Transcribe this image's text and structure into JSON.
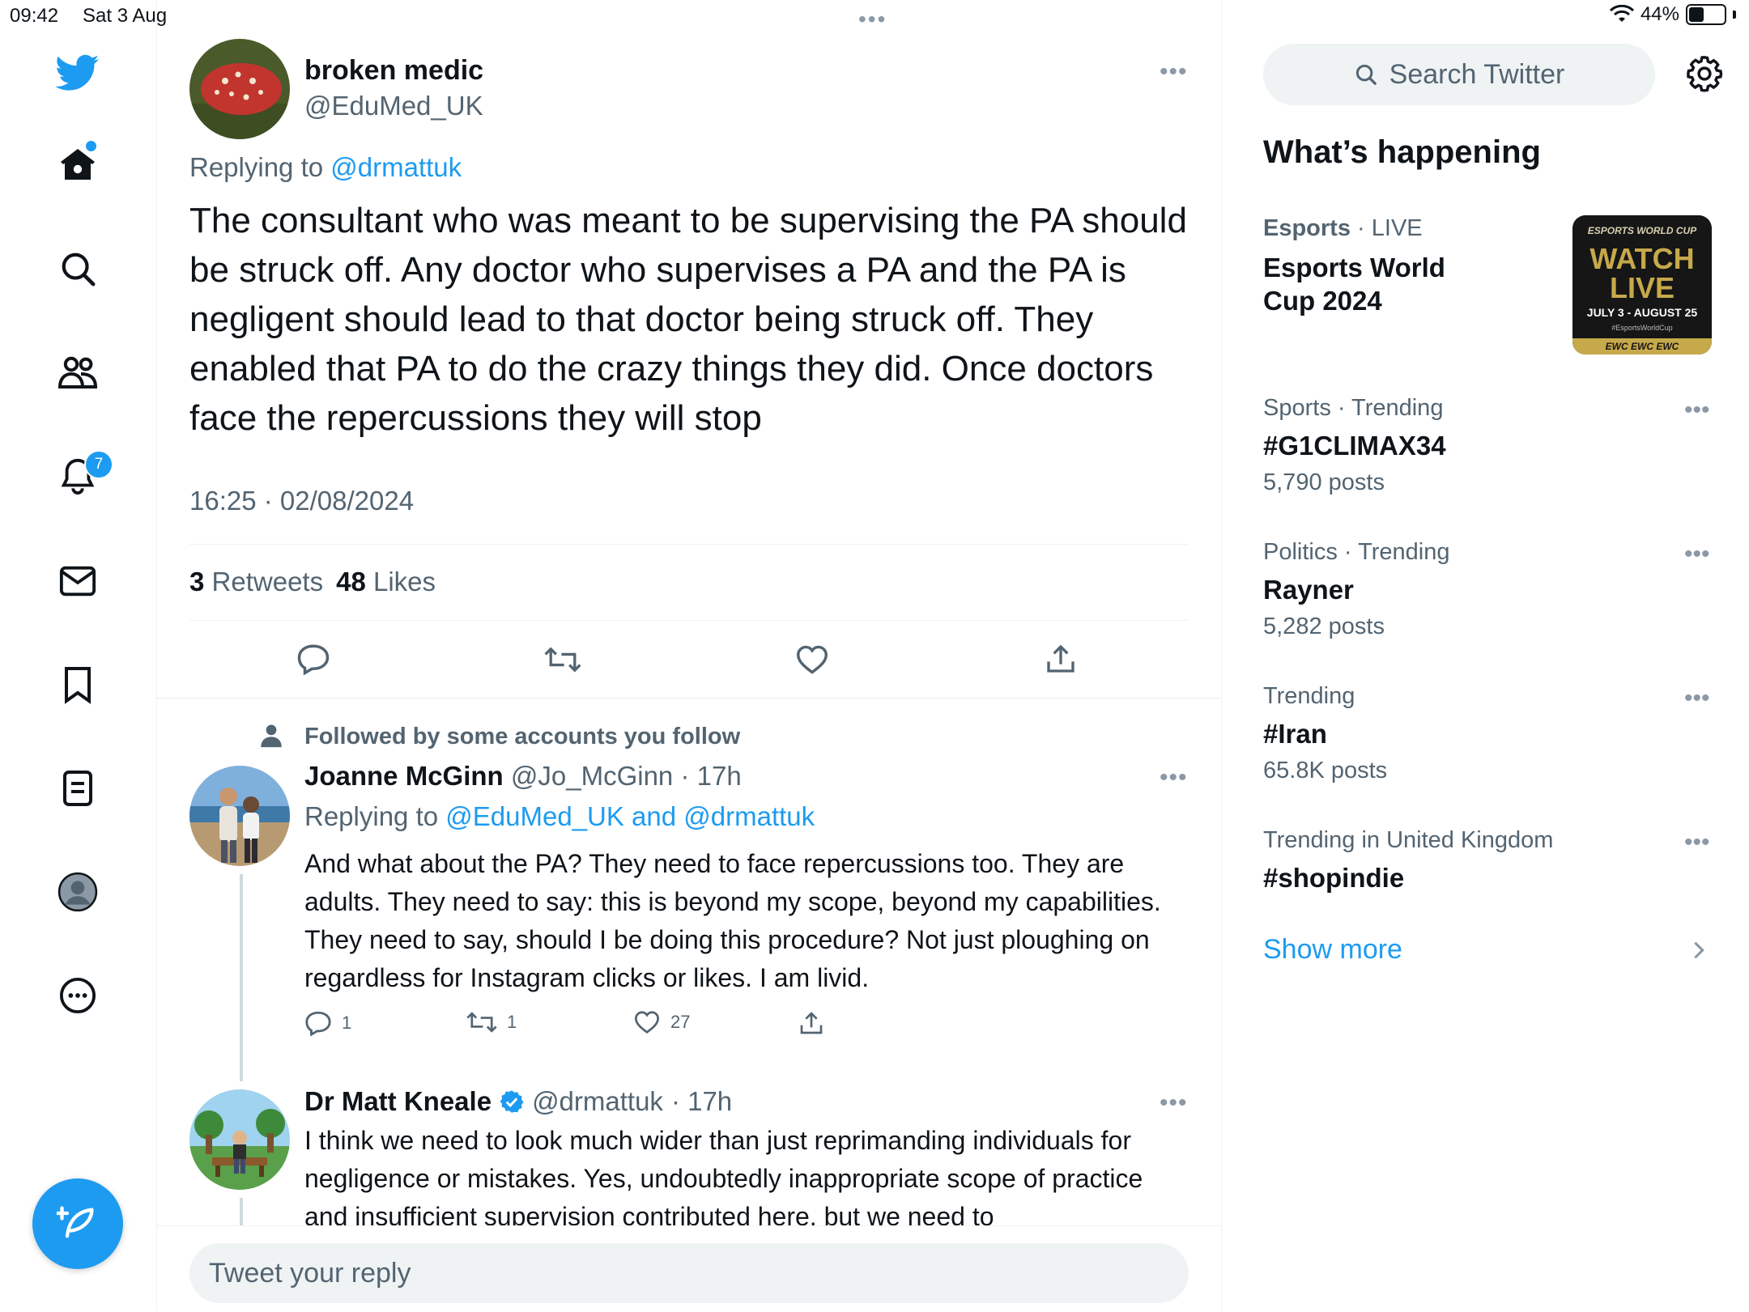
{
  "status_bar": {
    "time": "09:42",
    "date": "Sat 3 Aug",
    "battery": "44%",
    "battery_level": 0.44
  },
  "nav": {
    "notifications_badge": "7"
  },
  "main_tweet": {
    "name": "broken medic",
    "handle": "@EduMed_UK",
    "replying_prefix": "Replying to",
    "replying_to": "@drmattuk",
    "text": "The consultant who was meant to be supervising the PA should be struck off. Any doctor who supervises a PA and the PA is negligent should lead to that doctor being struck off. They enabled that PA to do the crazy things they did. Once doctors face the repercussions they will stop",
    "timestamp": "16:25 · 02/08/2024",
    "retweets_count": "3",
    "retweets_label": "Retweets",
    "likes_count": "48",
    "likes_label": "Likes"
  },
  "replies": [
    {
      "social_context": "Followed by some accounts you follow",
      "name": "Joanne McGinn",
      "handle": "@Jo_McGinn",
      "time": "· 17h",
      "replying_prefix": "Replying to",
      "replying_to": "@EduMed_UK and @drmattuk",
      "text": "And what about the PA? They need to face repercussions too. They are adults. They need to say: this is beyond my scope, beyond my capabilities. They need to say, should I be doing this procedure? Not just ploughing on regardless for Instagram clicks or likes. I am livid.",
      "reply_count": "1",
      "retweet_count": "1",
      "like_count": "27"
    },
    {
      "name": "Dr Matt Kneale",
      "handle": "@drmattuk",
      "time": "· 17h",
      "text": "I think we need to look much wider than just reprimanding individuals for negligence or mistakes. Yes, undoubtedly inappropriate scope of practice and insufficient supervision contributed here, but we need to"
    }
  ],
  "reply_box": {
    "placeholder": "Tweet your reply"
  },
  "sidebar": {
    "search_placeholder": "Search Twitter",
    "heading": "What’s happening",
    "featured": {
      "category": "Esports",
      "live": "· LIVE",
      "title": "Esports World Cup 2024",
      "image_top": "ESPORTS WORLD CUP",
      "image_main": "WATCH LIVE",
      "image_dates": "JULY 3 - AUGUST 25",
      "image_tag": "#EsportsWorldCup",
      "image_strip": "EWC EWC EWC"
    },
    "trends": [
      {
        "meta": "Sports · Trending",
        "name": "#G1CLIMAX34",
        "count": "5,790 posts"
      },
      {
        "meta": "Politics · Trending",
        "name": "Rayner",
        "count": "5,282 posts"
      },
      {
        "meta": "Trending",
        "name": "#Iran",
        "count": "65.8K posts"
      },
      {
        "meta": "Trending in United Kingdom",
        "name": "#shopindie",
        "count": ""
      }
    ],
    "show_more": "Show more"
  },
  "colors": {
    "accent": "#1d9bf0",
    "text": "#0f1419",
    "muted": "#536471",
    "border": "#eff3f4"
  }
}
